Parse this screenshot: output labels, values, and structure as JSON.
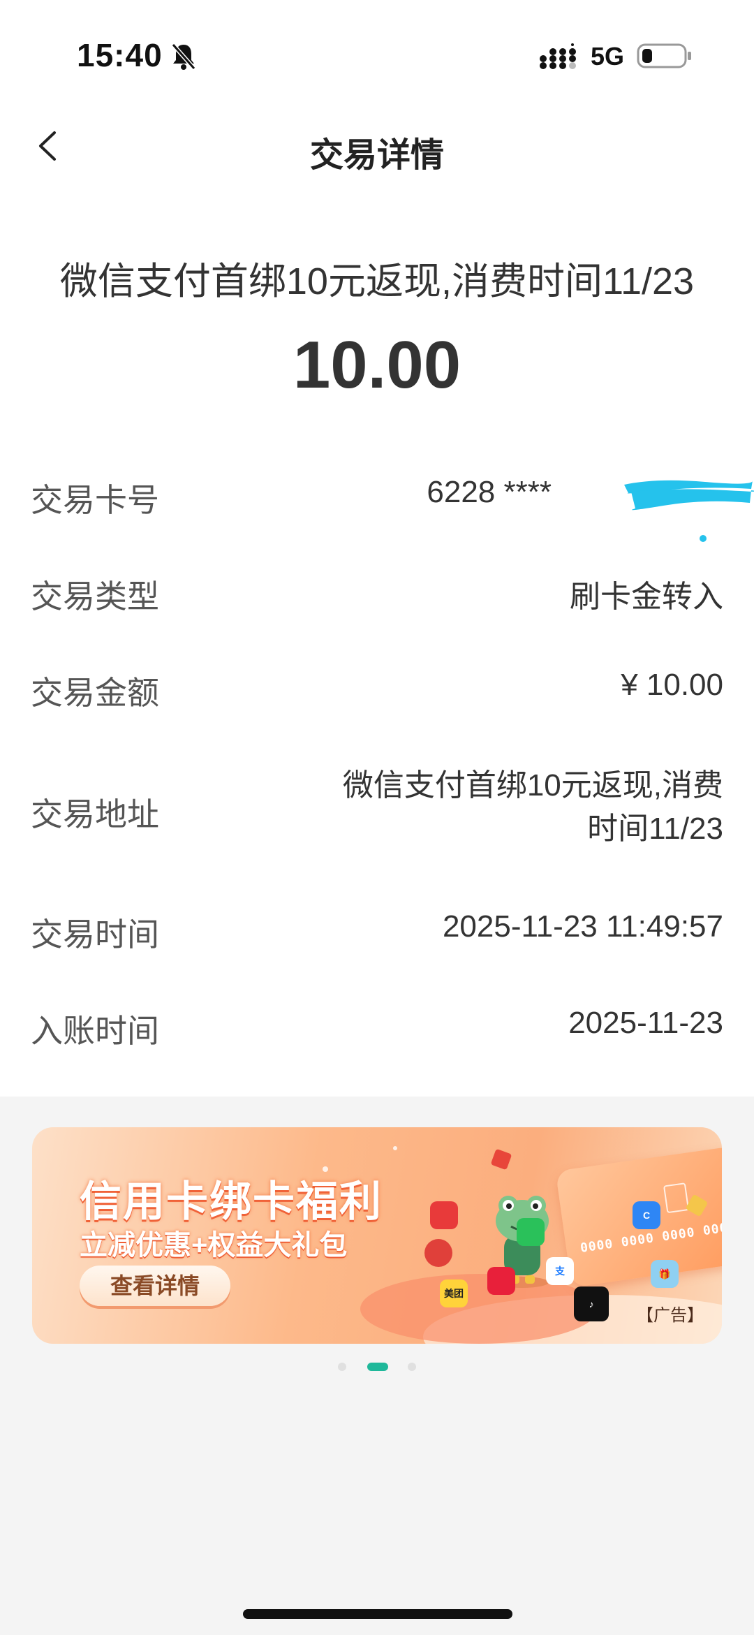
{
  "status_bar": {
    "time": "15:40",
    "network": "5G",
    "icons": [
      "bell-muted-icon",
      "signal-icon",
      "battery-icon"
    ]
  },
  "nav": {
    "title": "交易详情",
    "back_icon": "chevron-left-icon"
  },
  "summary": {
    "description": "微信支付首绑10元返现,消费时间11/23",
    "amount": "10.00"
  },
  "details": [
    {
      "label": "交易卡号",
      "value": "6228 ****"
    },
    {
      "label": "交易类型",
      "value": "刷卡金转入"
    },
    {
      "label": "交易金额",
      "value": "¥ 10.00"
    },
    {
      "label": "交易地址",
      "value_line1": "微信支付首绑10元返现,消费",
      "value_line2": "时间11/23"
    },
    {
      "label": "交易时间",
      "value": "2025-11-23 11:49:57"
    },
    {
      "label": "入账时间",
      "value": "2025-11-23"
    }
  ],
  "banner": {
    "title": "信用卡绑卡福利",
    "subtitle": "立减优惠+权益大礼包",
    "button_label": "查看详情",
    "card_number": "0000 0000 0000 000",
    "ad_label": "【广告】",
    "meituan_label": "美团"
  },
  "pager": {
    "count": 3,
    "active_index": 1
  },
  "colors": {
    "accent": "#1fb89a",
    "redaction": "#25c2ec",
    "banner_orange": "#fbae7e",
    "text_primary": "#333333"
  }
}
